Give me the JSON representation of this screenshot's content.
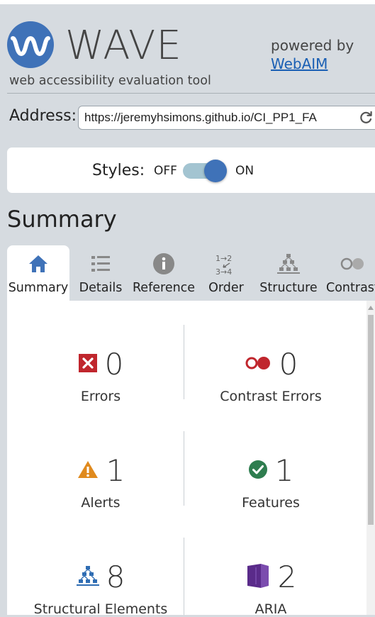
{
  "header": {
    "title": "WAVE",
    "tagline": "web accessibility evaluation tool",
    "powered_by": "powered by",
    "webaim_link": "WebAIM"
  },
  "address": {
    "label": "Address:",
    "value": "https://jeremyhsimons.github.io/CI_PP1_FA"
  },
  "styles": {
    "label": "Styles:",
    "off": "OFF",
    "on": "ON",
    "state": "on"
  },
  "summary_heading": "Summary",
  "tabs": [
    {
      "label": "Summary",
      "icon": "home-icon",
      "active": true
    },
    {
      "label": "Details",
      "icon": "list-icon"
    },
    {
      "label": "Reference",
      "icon": "info-icon"
    },
    {
      "label": "Order",
      "icon": "order-icon"
    },
    {
      "label": "Structure",
      "icon": "structure-icon"
    },
    {
      "label": "Contrast",
      "icon": "contrast-icon"
    }
  ],
  "stats": {
    "errors": {
      "count": "0",
      "label": "Errors"
    },
    "contrast_errors": {
      "count": "0",
      "label": "Contrast Errors"
    },
    "alerts": {
      "count": "1",
      "label": "Alerts"
    },
    "features": {
      "count": "1",
      "label": "Features"
    },
    "structural": {
      "count": "8",
      "label": "Structural Elements"
    },
    "aria": {
      "count": "2",
      "label": "ARIA"
    }
  },
  "colors": {
    "logo_blue": "#3f72b8",
    "error_red": "#c0262d",
    "alert_orange": "#e08a1e",
    "feature_green": "#2e7d4f",
    "structure_blue": "#2f6db3",
    "aria_purple": "#5a2b8a"
  }
}
